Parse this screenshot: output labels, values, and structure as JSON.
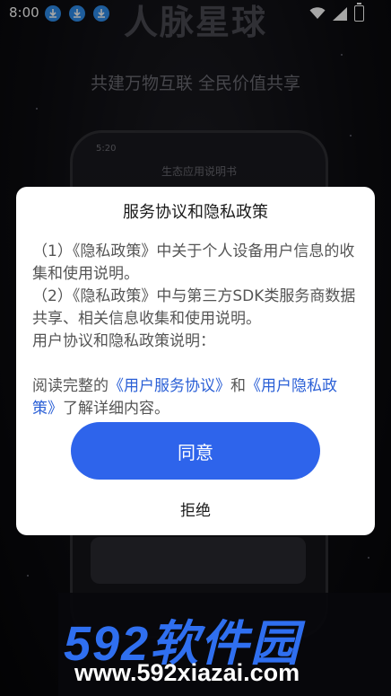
{
  "status_bar": {
    "time": "8:00",
    "notification_icons": [
      "download-icon",
      "download-icon",
      "download-icon"
    ]
  },
  "background": {
    "app_title": "人脉星球",
    "slogan": "共建万物互联 全民价值共享",
    "phone_mockup": {
      "time": "5:20",
      "screen_title": "生态应用说明书"
    }
  },
  "dialog": {
    "title": "服务协议和隐私政策",
    "lines": [
      "（1）《隐私政策》中关于个人设备用户信息的收集和使用说明。",
      "（2）《隐私政策》中与第三方SDK类服务商数据共享、相关信息收集和使用说明。",
      "用户协议和隐私政策说明："
    ],
    "read_prefix": "阅读完整的",
    "user_agreement_link": "《用户服务协议》",
    "and_text": "和",
    "privacy_link": "《用户隐私政策》",
    "read_suffix": "了解详细内容。",
    "agree_label": "同意",
    "reject_label": "拒绝"
  },
  "watermark": {
    "logo": "592软件园",
    "url": "www.592xiazai.com"
  },
  "colors": {
    "primary_button": "#2e64eb",
    "link": "#2a5fd6",
    "download_badge": "#2f8ff0"
  }
}
